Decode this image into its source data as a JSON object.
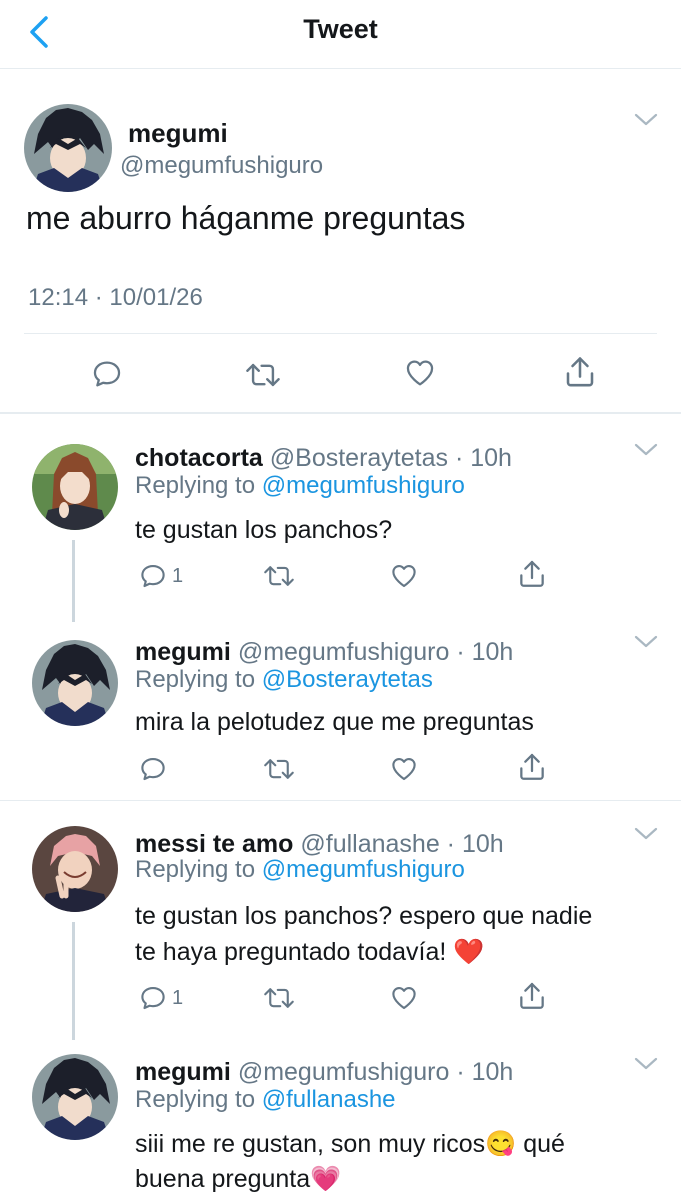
{
  "header": {
    "title": "Tweet"
  },
  "main_tweet": {
    "name": "megumi",
    "handle": "@megumfushiguro",
    "text": "me aburro háganme preguntas",
    "timestamp": "12:14 · 10/01/26"
  },
  "replies": [
    {
      "name": "chotacorta",
      "meta": "@Bosteraytetas · 10h",
      "replying_prefix": "Replying to",
      "replying_to": "@megumfushiguro",
      "lines": [
        "te gustan los panchos?"
      ],
      "reply_count": "1"
    },
    {
      "name": "megumi",
      "meta": "@megumfushiguro · 10h",
      "replying_prefix": "Replying to",
      "replying_to": "@Bosteraytetas",
      "lines": [
        "mira la pelotudez que me preguntas"
      ],
      "reply_count": ""
    },
    {
      "name": "messi te amo",
      "meta": "@fullanashe · 10h",
      "replying_prefix": "Replying to",
      "replying_to": "@megumfushiguro",
      "lines": [
        "te gustan los panchos? espero que nadie",
        "te haya preguntado todavía! ❤️"
      ],
      "reply_count": "1"
    },
    {
      "name": "megumi",
      "meta": "@megumfushiguro · 10h",
      "replying_prefix": "Replying to",
      "replying_to": "@fullanashe",
      "lines": [
        "siii me re gustan, son muy ricos😋 qué",
        "buena pregunta💗"
      ],
      "reply_count": ""
    }
  ],
  "colors": {
    "link": "#1b95e0",
    "muted": "#657786",
    "text": "#14171a",
    "heart_emoji": "#e0245e"
  }
}
